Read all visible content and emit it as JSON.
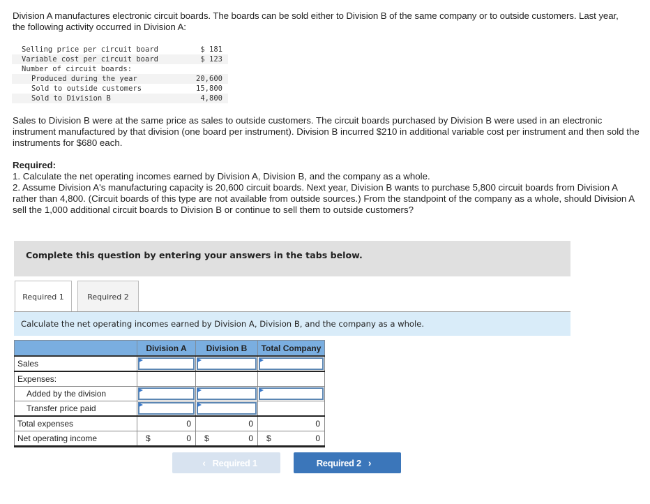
{
  "intro": "Division A manufactures electronic circuit boards. The boards can be sold either to Division B of the same company or to outside customers. Last year, the following activity occurred in Division A:",
  "activity": [
    {
      "label": "Selling price per circuit board",
      "value": "$ 181",
      "indent": false
    },
    {
      "label": "Variable cost per circuit board",
      "value": "$ 123",
      "indent": false
    },
    {
      "label": "Number of circuit boards:",
      "value": "",
      "indent": false
    },
    {
      "label": "Produced during the year",
      "value": "20,600",
      "indent": true
    },
    {
      "label": "Sold to outside customers",
      "value": "15,800",
      "indent": true
    },
    {
      "label": "Sold to Division B",
      "value": "4,800",
      "indent": true
    }
  ],
  "paragraph2": "Sales to Division B were at the same price as sales to outside customers. The circuit boards purchased by Division B were used in an electronic instrument manufactured by that division (one board per instrument). Division B incurred $210 in additional variable cost per instrument and then sold the instruments for $680 each.",
  "required": {
    "heading": "Required:",
    "items": [
      "1. Calculate the net operating incomes earned by Division A, Division B, and the company as a whole.",
      "2. Assume Division A's manufacturing capacity is 20,600 circuit boards. Next year, Division B wants to purchase 5,800 circuit boards from Division A rather than 4,800. (Circuit boards of this type are not available from outside sources.) From the standpoint of the company as a whole, should Division A sell the 1,000 additional circuit boards to Division B or continue to sell them to outside customers?"
    ]
  },
  "banner": "Complete this question by entering your answers in the tabs below.",
  "tabs": [
    {
      "label": "Required 1",
      "active": true
    },
    {
      "label": "Required 2",
      "active": false
    }
  ],
  "instruction": "Calculate the net operating incomes earned by Division A, Division B, and the company as a whole.",
  "table": {
    "headers": [
      "",
      "Division A",
      "Division B",
      "Total Company"
    ],
    "rows": {
      "sales": "Sales",
      "expenses": "Expenses:",
      "added": "Added by the division",
      "transfer": "Transfer price paid",
      "total_expenses": "Total expenses",
      "net_income": "Net operating income"
    },
    "total_expenses_values": [
      "0",
      "0",
      "0"
    ],
    "net_income_values": [
      "0",
      "0",
      "0"
    ],
    "currency": "$",
    "inputs": {
      "sales": [
        "",
        "",
        ""
      ],
      "added": [
        "",
        "",
        ""
      ],
      "transfer": [
        "",
        ""
      ]
    }
  },
  "nav": {
    "prev_label": "Required 1",
    "next_label": "Required 2",
    "prev_icon": "‹",
    "next_icon": "›"
  }
}
